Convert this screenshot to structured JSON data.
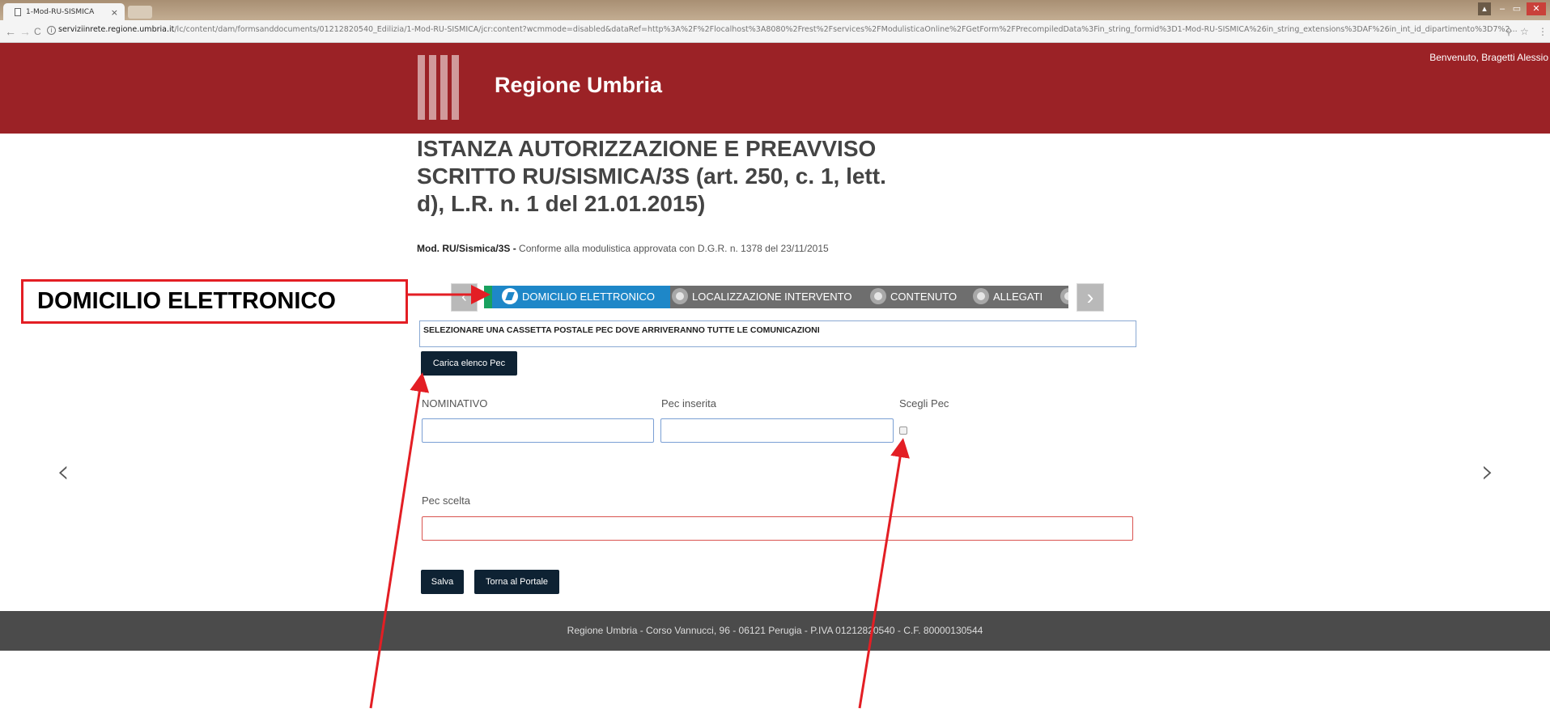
{
  "browser": {
    "tab_title": "1-Mod-RU-SISMICA",
    "tab_close": "×",
    "url_host": "serviziinrete.regione.umbria.it",
    "url_path": "/lc/content/dam/formsanddocuments/01212820540_Edilizia/1-Mod-RU-SISMICA/jcr:content?wcmmode=disabled&dataRef=http%3A%2F%2Flocalhost%3A8080%2Frest%2Fservices%2FModulisticaOnline%2FGetForm%2FPrecompiledData%3Fin_string_formid%3D1-Mod-RU-SISMICA%26in_string_extensions%3DAF%26in_int_id_dipartimento%3D7%2..."
  },
  "header": {
    "brand": "Regione Umbria",
    "welcome": "Benvenuto, Bragetti Alessio"
  },
  "page": {
    "title": "ISTANZA AUTORIZZAZIONE E PREAVVISO SCRITTO RU/SISMICA/3S (art. 250, c. 1, lett. d), L.R. n. 1 del 21.01.2015)",
    "subtitle_bold": "Mod. RU/Sismica/3S - ",
    "subtitle_text": "Conforme alla modulistica approvata con D.G.R. n. 1378 del  23/11/2015"
  },
  "wizard": {
    "steps": [
      {
        "label": "DOMICILIO ELETTRONICO",
        "active": true
      },
      {
        "label": "LOCALIZZAZIONE INTERVENTO",
        "active": false
      },
      {
        "label": "CONTENUTO",
        "active": false
      },
      {
        "label": "ALLEGATI",
        "active": false
      }
    ]
  },
  "form": {
    "info": "SELEZIONARE UNA CASSETTA POSTALE PEC DOVE ARRIVERANNO TUTTE LE COMUNICAZIONI",
    "load_button": "Carica elenco Pec",
    "col_nominativo": "NOMINATIVO",
    "col_pec_inserita": "Pec inserita",
    "col_scegli": "Scegli Pec",
    "nominativo_value": "",
    "pec_inserita_value": "",
    "pec_scelta_label": "Pec scelta",
    "pec_scelta_value": "",
    "save_button": "Salva",
    "back_button": "Torna al Portale"
  },
  "footer": {
    "text": "Regione Umbria - Corso Vannucci, 96 - 06121 Perugia - P.IVA 01212820540 - C.F. 80000130544"
  },
  "annotation": {
    "callout": "DOMICILIO ELETTRONICO",
    "color": "#e31e24"
  },
  "colors": {
    "header_red": "#9b2226",
    "active_step_blue": "#1e87c8",
    "button_dark": "#0e2233"
  }
}
